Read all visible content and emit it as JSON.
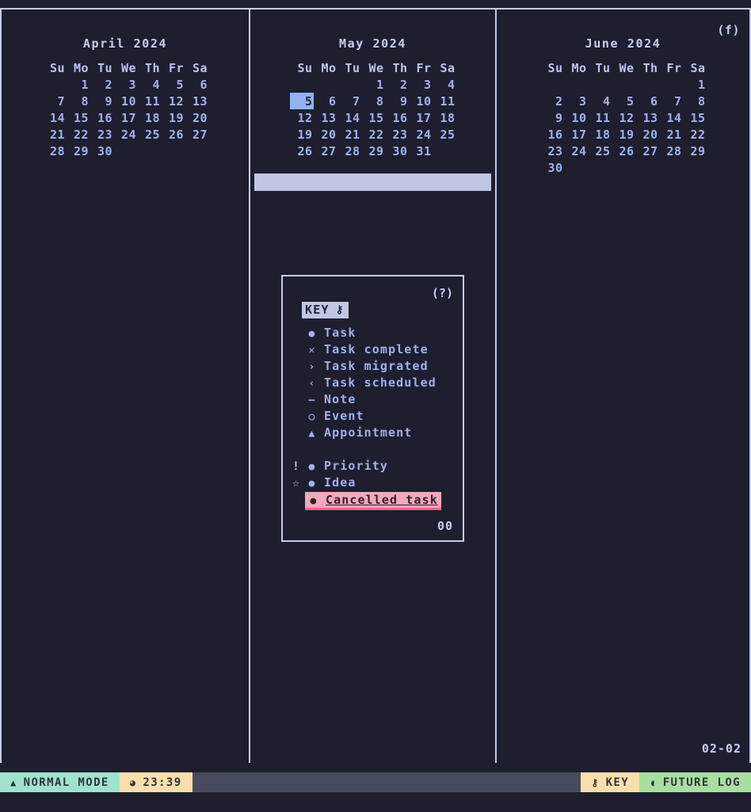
{
  "app": {
    "bottom_right_date": "02-02"
  },
  "columns": [
    {
      "corner_tag": "",
      "month": {
        "title": "April 2024",
        "weekdays": [
          "Su",
          "Mo",
          "Tu",
          "We",
          "Th",
          "Fr",
          "Sa"
        ],
        "weeks": [
          [
            "",
            "1",
            "2",
            "3",
            "4",
            "5",
            "6"
          ],
          [
            "7",
            "8",
            "9",
            "10",
            "11",
            "12",
            "13"
          ],
          [
            "14",
            "15",
            "16",
            "17",
            "18",
            "19",
            "20"
          ],
          [
            "21",
            "22",
            "23",
            "24",
            "25",
            "26",
            "27"
          ],
          [
            "28",
            "29",
            "30",
            "",
            "",
            "",
            ""
          ]
        ],
        "today": ""
      }
    },
    {
      "corner_tag": "",
      "month": {
        "title": "May 2024",
        "weekdays": [
          "Su",
          "Mo",
          "Tu",
          "We",
          "Th",
          "Fr",
          "Sa"
        ],
        "weeks": [
          [
            "",
            "",
            "",
            "1",
            "2",
            "3",
            "4"
          ],
          [
            "5",
            "6",
            "7",
            "8",
            "9",
            "10",
            "11"
          ],
          [
            "12",
            "13",
            "14",
            "15",
            "16",
            "17",
            "18"
          ],
          [
            "19",
            "20",
            "21",
            "22",
            "23",
            "24",
            "25"
          ],
          [
            "26",
            "27",
            "28",
            "29",
            "30",
            "31",
            ""
          ]
        ],
        "today": "5"
      }
    },
    {
      "corner_tag": "(f)",
      "month": {
        "title": "June 2024",
        "weekdays": [
          "Su",
          "Mo",
          "Tu",
          "We",
          "Th",
          "Fr",
          "Sa"
        ],
        "weeks": [
          [
            "",
            "",
            "",
            "",
            "",
            "",
            "1"
          ],
          [
            "2",
            "3",
            "4",
            "5",
            "6",
            "7",
            "8"
          ],
          [
            "9",
            "10",
            "11",
            "12",
            "13",
            "14",
            "15"
          ],
          [
            "16",
            "17",
            "18",
            "19",
            "20",
            "21",
            "22"
          ],
          [
            "23",
            "24",
            "25",
            "26",
            "27",
            "28",
            "29"
          ],
          [
            "30",
            "",
            "",
            "",
            "",
            "",
            ""
          ]
        ],
        "today": ""
      }
    }
  ],
  "key_popup": {
    "help_tag": "(?)",
    "title": "KEY",
    "title_icon": "key-icon",
    "count": "00",
    "entries": [
      {
        "prefix": "",
        "symbol": "●",
        "label": "Task",
        "style": "normal"
      },
      {
        "prefix": "",
        "symbol": "✕",
        "label": "Task complete",
        "style": "normal"
      },
      {
        "prefix": "",
        "symbol": "›",
        "label": "Task migrated",
        "style": "normal"
      },
      {
        "prefix": "",
        "symbol": "‹",
        "label": "Task scheduled",
        "style": "normal"
      },
      {
        "prefix": "",
        "symbol": "–",
        "label": "Note",
        "style": "normal"
      },
      {
        "prefix": "",
        "symbol": "○",
        "label": "Event",
        "style": "normal"
      },
      {
        "prefix": "",
        "symbol": "▲",
        "label": "Appointment",
        "style": "normal"
      },
      {
        "prefix": "",
        "symbol": "",
        "label": "",
        "style": "gap"
      },
      {
        "prefix": "!",
        "symbol": "●",
        "label": "Priority",
        "style": "normal"
      },
      {
        "prefix": "☆",
        "symbol": "●",
        "label": "Idea",
        "style": "normal"
      },
      {
        "prefix": "",
        "symbol": "●",
        "label": "Cancelled task",
        "style": "cancelled"
      }
    ]
  },
  "statusbar": {
    "mode": {
      "icon": "▲",
      "icon_name": "triangle-up-icon",
      "label": "NORMAL MODE"
    },
    "clock": {
      "icon": "◕",
      "icon_name": "clock-icon",
      "label": "23:39"
    },
    "key": {
      "icon": "⚷",
      "icon_name": "key-icon",
      "label": "KEY"
    },
    "future_log": {
      "icon": "◖",
      "icon_name": "leaf-icon",
      "label": "FUTURE LOG"
    }
  },
  "colors": {
    "background": "#1e1e2e",
    "border": "#c5cbe8",
    "text": "#9fb2ef",
    "today_highlight": "#8fb3f5",
    "selection_bar": "#c0c6e3",
    "cancelled_bg": "#f5a8bb",
    "status_mode": "#9fe3cd",
    "status_clock": "#fadfab",
    "status_future": "#a8dfa0",
    "status_base": "#474b5e"
  }
}
